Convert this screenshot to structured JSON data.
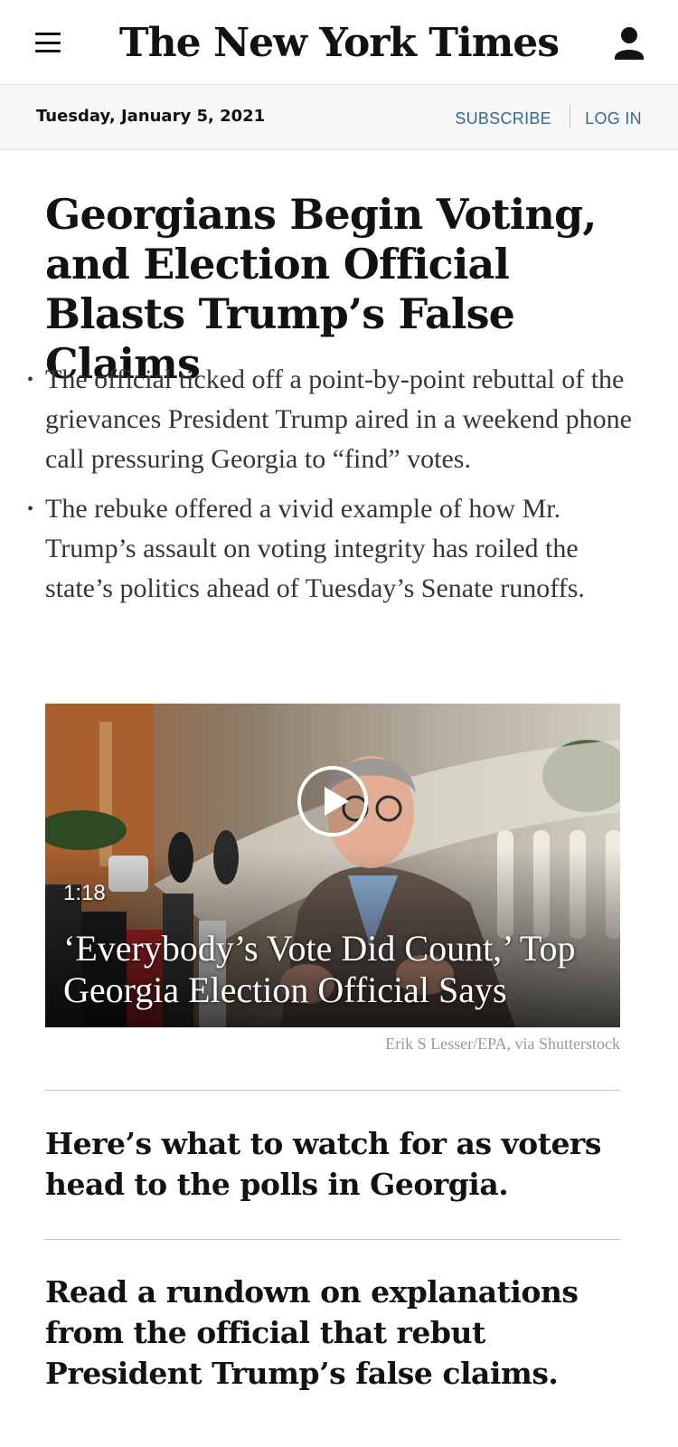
{
  "header": {
    "logo_text": "The New York Times",
    "menu_icon": "hamburger-menu-icon",
    "account_icon": "user-icon"
  },
  "datebar": {
    "date": "Tuesday, January 5, 2021",
    "subscribe_label": "SUBSCRIBE",
    "login_label": "LOG IN",
    "link_color": "#326891"
  },
  "article": {
    "headline": "Georgians Begin Voting, and Election Official Blasts Trump’s False Claims",
    "summary": [
      "The official ticked off a point-by-point rebuttal of the grievances President Trump aired in a weekend phone call pressuring Georgia to “find” votes.",
      "The rebuke offered a vivid example of how Mr. Trump’s assault on voting integrity has roiled the state’s politics ahead of Tuesday’s Senate runoffs."
    ],
    "video": {
      "duration": "1:18",
      "title": "‘Everybody’s Vote Did Count,’ Top Georgia Election Official Says",
      "play_icon": "play-icon",
      "credit": "Erik S Lesser/EPA, via Shutterstock"
    },
    "related": [
      "Here’s what to watch for as voters head to the polls in Georgia.",
      "Read a rundown on explanations from the official that rebut President Trump’s false claims."
    ]
  }
}
